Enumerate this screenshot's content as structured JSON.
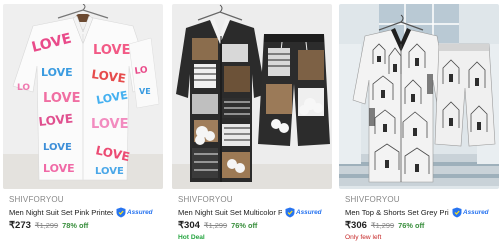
{
  "colors": {
    "assured": "#2874f0",
    "discount": "#388e3c",
    "hot_deal": "#26a541",
    "few_left": "#c62828",
    "muted": "#878787"
  },
  "products": [
    {
      "brand": "SHIVFORYOU",
      "title": "Men Night Suit Set Pink Printed",
      "assured": "Assured",
      "price": "₹273",
      "mrp": "₹1,299",
      "discount": "78% off",
      "tag": ""
    },
    {
      "brand": "SHIVFORYOU",
      "title": "Men Night Suit Set Multicolor Print...",
      "assured": "Assured",
      "price": "₹304",
      "mrp": "₹1,299",
      "discount": "76% off",
      "tag": "Hot Deal"
    },
    {
      "brand": "SHIVFORYOU",
      "title": "Men Top & Shorts Set Grey Print...",
      "assured": "Assured",
      "price": "₹306",
      "mrp": "₹1,299",
      "discount": "76% off",
      "tag": "Only few left"
    }
  ]
}
